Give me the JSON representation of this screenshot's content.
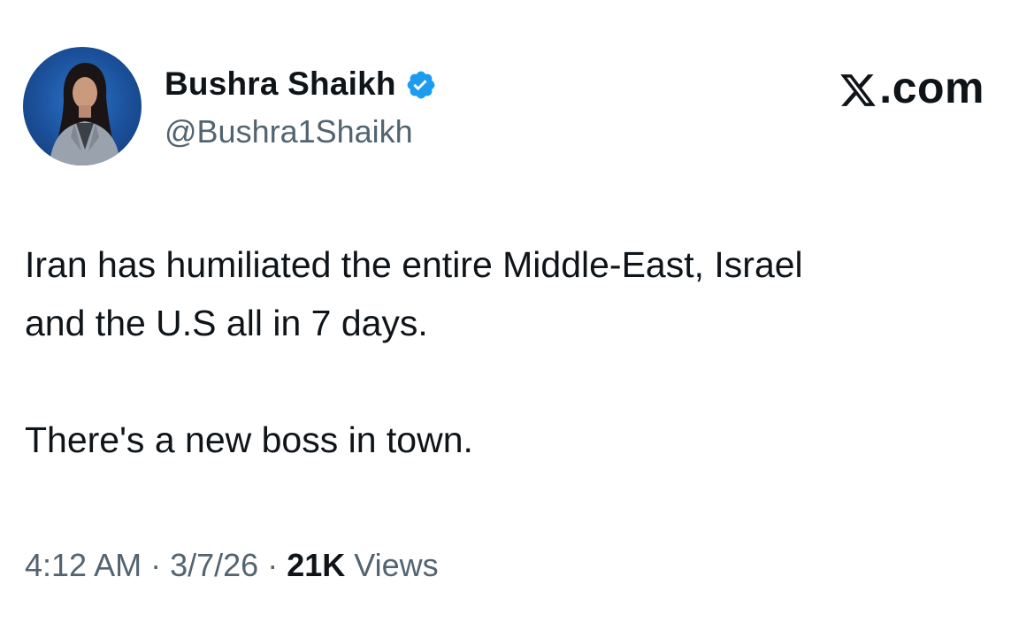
{
  "author": {
    "display_name": "Bushra Shaikh",
    "handle": "@Bushra1Shaikh",
    "verified": true,
    "avatar_icon": "profile-photo",
    "badge_icon": "verified-badge-icon",
    "badge_color": "#1d9bf0"
  },
  "site": {
    "logo_icon": "x-logo-icon",
    "label": ".com"
  },
  "tweet": {
    "line1": "Iran has humiliated the entire Middle-East, Israel",
    "line2": "and the U.S all in 7 days.",
    "line3": "There's a new boss in town."
  },
  "meta": {
    "time": "4:12 AM",
    "separator": "·",
    "date": "3/7/26",
    "views_count": "21K",
    "views_label": "Views"
  },
  "colors": {
    "text_primary": "#0f1419",
    "text_secondary": "#536471",
    "accent": "#1d9bf0"
  }
}
